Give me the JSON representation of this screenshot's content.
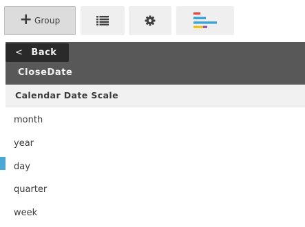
{
  "toolbar": {
    "group_label": "Group",
    "buttons": [
      {
        "name": "group-button",
        "icon": "plus-icon",
        "active": true
      },
      {
        "name": "list-button",
        "icon": "list-icon"
      },
      {
        "name": "settings-button",
        "icon": "gear-icon"
      },
      {
        "name": "chart-button",
        "icon": "bar-chart-icon"
      }
    ]
  },
  "panel": {
    "back_label": "Back",
    "field_name": "CloseDate"
  },
  "dropdown": {
    "title": "Calendar Date Scale",
    "options": [
      "month",
      "year",
      "day",
      "quarter",
      "week"
    ]
  },
  "colors": {
    "header_bg": "#585858",
    "back_bg": "#2a2a2a",
    "accent": "#4aa7d6",
    "chart_red": "#e24a4a",
    "chart_blue": "#39a4d8",
    "chart_yellow": "#f0c419",
    "chart_purple": "#9b59b6"
  }
}
